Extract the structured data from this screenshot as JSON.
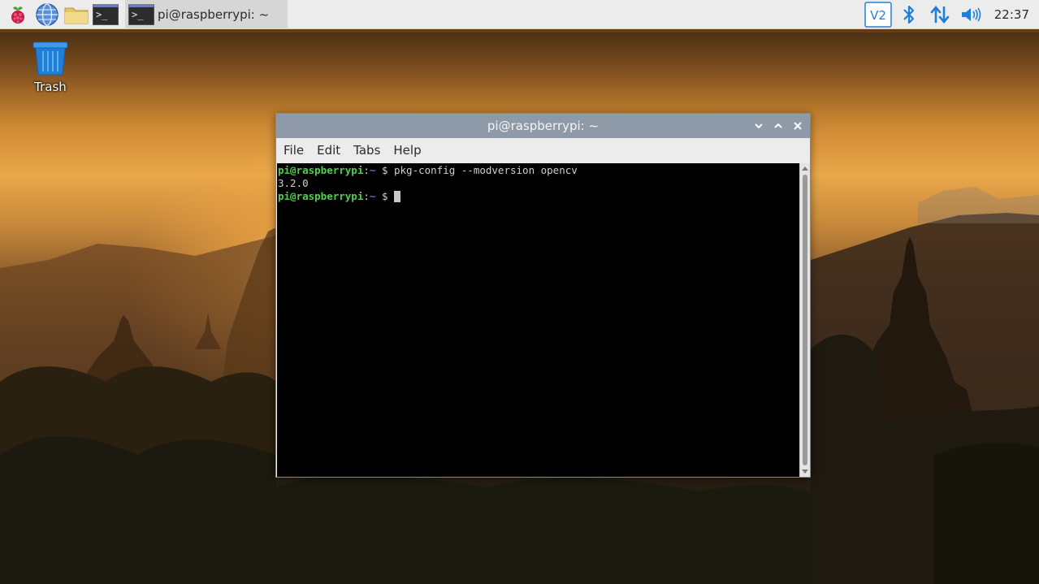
{
  "panel": {
    "launchers": [
      {
        "icon": "raspberry-menu-icon"
      },
      {
        "icon": "web-browser-icon"
      },
      {
        "icon": "file-manager-icon"
      },
      {
        "icon": "terminal-launcher-icon",
        "glyph": ">_"
      }
    ],
    "task": {
      "label": "pi@raspberrypi: ~",
      "glyph": ">_"
    },
    "tray": {
      "icons": [
        "vnc-icon",
        "bluetooth-icon",
        "network-icon",
        "volume-icon"
      ],
      "vnc_text": "V2",
      "clock": "22:37"
    }
  },
  "desktop": {
    "trash_label": "Trash"
  },
  "window": {
    "title": "pi@raspberrypi: ~",
    "menu": [
      "File",
      "Edit",
      "Tabs",
      "Help"
    ],
    "terminal": {
      "prompt_user": "pi@raspberrypi",
      "prompt_sep": ":",
      "prompt_dir": "~",
      "prompt_dollar": " $ ",
      "command": "pkg-config --modversion opencv",
      "output": "3.2.0"
    }
  },
  "colors": {
    "panel_bg": "#ececec",
    "titlebar": "#8e9aa8",
    "prompt_user": "#4fd04a",
    "prompt_dir": "#5a6cf0",
    "trash_blue": "#1f7fd8"
  }
}
